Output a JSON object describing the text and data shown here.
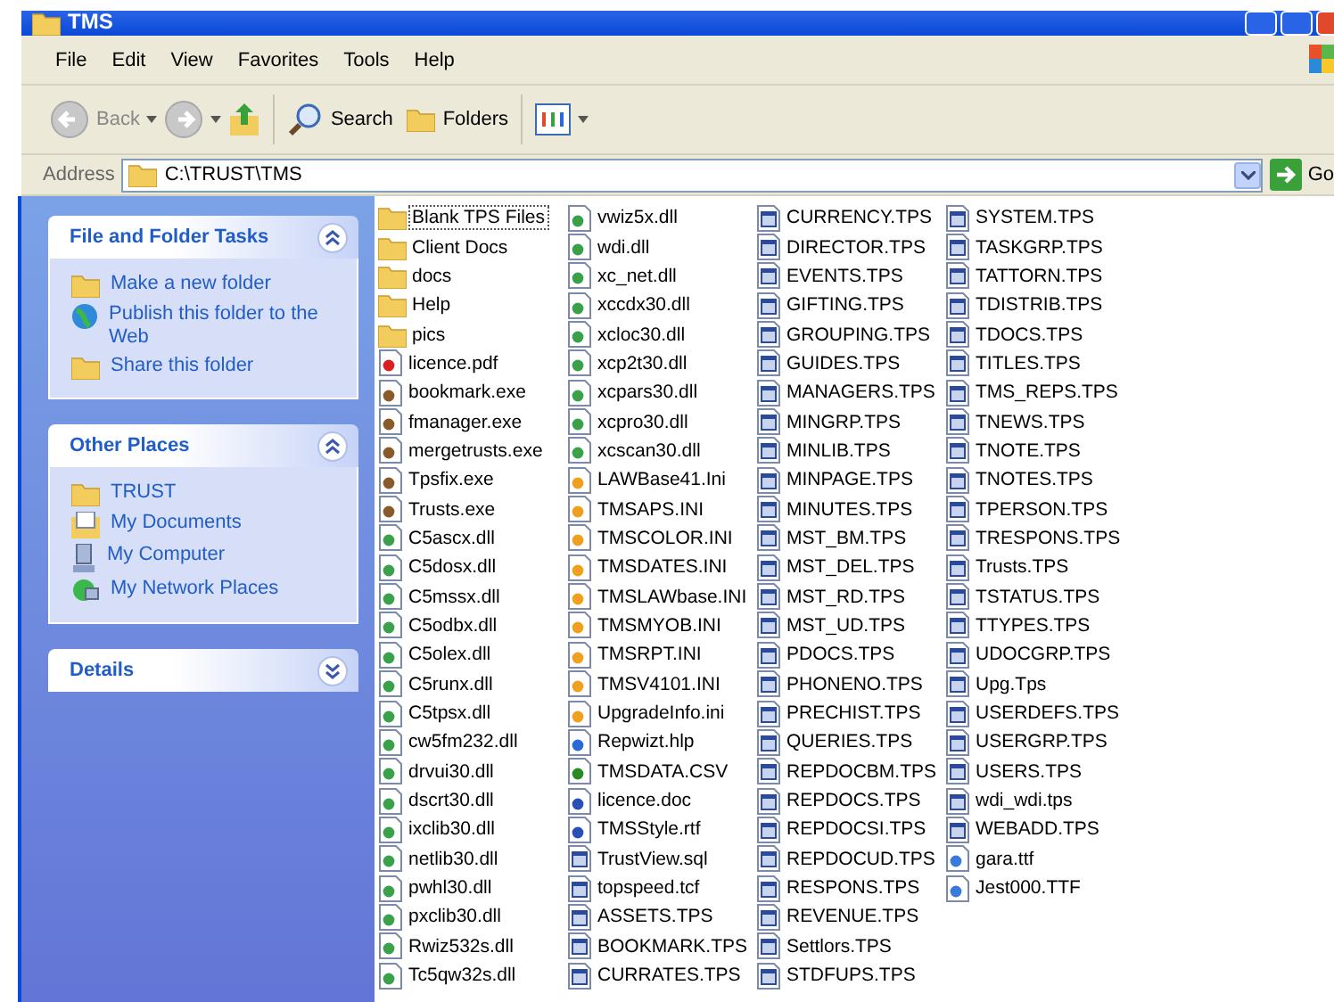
{
  "window": {
    "title": "TMS"
  },
  "menu": [
    "File",
    "Edit",
    "View",
    "Favorites",
    "Tools",
    "Help"
  ],
  "toolbar": {
    "back": {
      "label": "Back",
      "disabled": true
    },
    "forward": {
      "disabled": true
    },
    "search": "Search",
    "folders": "Folders"
  },
  "address": {
    "label": "Address",
    "value": "C:\\TRUST\\TMS",
    "go": "Go"
  },
  "task_panels": [
    {
      "title": "File and Folder Tasks",
      "expanded": true,
      "items": [
        {
          "label": "Make a new folder",
          "kind": "new-folder"
        },
        {
          "label": "Publish this folder to the Web",
          "kind": "globe"
        },
        {
          "label": "Share this folder",
          "kind": "share"
        }
      ]
    },
    {
      "title": "Other Places",
      "expanded": true,
      "items": [
        {
          "label": "TRUST",
          "kind": "folder"
        },
        {
          "label": "My Documents",
          "kind": "documents"
        },
        {
          "label": "My Computer",
          "kind": "computer"
        },
        {
          "label": "My Network Places",
          "kind": "network"
        }
      ]
    },
    {
      "title": "Details",
      "expanded": false
    }
  ],
  "files": {
    "columns": [
      [
        {
          "name": "Blank TPS Files",
          "kind": "folder",
          "focused": true
        },
        {
          "name": "Client Docs",
          "kind": "folder",
          "focused": false
        },
        {
          "name": "docs",
          "kind": "folder",
          "focused": false
        },
        {
          "name": "Help",
          "kind": "folder",
          "focused": false
        },
        {
          "name": "pics",
          "kind": "folder",
          "focused": false
        },
        {
          "name": "licence.pdf",
          "kind": "pdf",
          "focused": false
        },
        {
          "name": "bookmark.exe",
          "kind": "exe",
          "focused": false
        },
        {
          "name": "fmanager.exe",
          "kind": "exe",
          "focused": false
        },
        {
          "name": "mergetrusts.exe",
          "kind": "exe",
          "focused": false
        },
        {
          "name": "Tpsfix.exe",
          "kind": "exe",
          "focused": false
        },
        {
          "name": "Trusts.exe",
          "kind": "exe",
          "focused": false
        },
        {
          "name": "C5ascx.dll",
          "kind": "dll",
          "focused": false
        },
        {
          "name": "C5dosx.dll",
          "kind": "dll",
          "focused": false
        },
        {
          "name": "C5mssx.dll",
          "kind": "dll",
          "focused": false
        },
        {
          "name": "C5odbx.dll",
          "kind": "dll",
          "focused": false
        },
        {
          "name": "C5olex.dll",
          "kind": "dll",
          "focused": false
        },
        {
          "name": "C5runx.dll",
          "kind": "dll",
          "focused": false
        },
        {
          "name": "C5tpsx.dll",
          "kind": "dll",
          "focused": false
        },
        {
          "name": "cw5fm232.dll",
          "kind": "dll",
          "focused": false
        },
        {
          "name": "drvui30.dll",
          "kind": "dll",
          "focused": false
        },
        {
          "name": "dscrt30.dll",
          "kind": "dll",
          "focused": false
        },
        {
          "name": "ixclib30.dll",
          "kind": "dll",
          "focused": false
        },
        {
          "name": "netlib30.dll",
          "kind": "dll",
          "focused": false
        },
        {
          "name": "pwhl30.dll",
          "kind": "dll",
          "focused": false
        },
        {
          "name": "pxclib30.dll",
          "kind": "dll",
          "focused": false
        },
        {
          "name": "Rwiz532s.dll",
          "kind": "dll",
          "focused": false
        },
        {
          "name": "Tc5qw32s.dll",
          "kind": "dll",
          "focused": false
        }
      ],
      [
        {
          "name": "vwiz5x.dll",
          "kind": "dll",
          "focused": false
        },
        {
          "name": "wdi.dll",
          "kind": "dll",
          "focused": false
        },
        {
          "name": "xc_net.dll",
          "kind": "dll",
          "focused": false
        },
        {
          "name": "xccdx30.dll",
          "kind": "dll",
          "focused": false
        },
        {
          "name": "xcloc30.dll",
          "kind": "dll",
          "focused": false
        },
        {
          "name": "xcp2t30.dll",
          "kind": "dll",
          "focused": false
        },
        {
          "name": "xcpars30.dll",
          "kind": "dll",
          "focused": false
        },
        {
          "name": "xcpro30.dll",
          "kind": "dll",
          "focused": false
        },
        {
          "name": "xcscan30.dll",
          "kind": "dll",
          "focused": false
        },
        {
          "name": "LAWBase41.Ini",
          "kind": "ini",
          "focused": false
        },
        {
          "name": "TMSAPS.INI",
          "kind": "ini",
          "focused": false
        },
        {
          "name": "TMSCOLOR.INI",
          "kind": "ini",
          "focused": false
        },
        {
          "name": "TMSDATES.INI",
          "kind": "ini",
          "focused": false
        },
        {
          "name": "TMSLAWbase.INI",
          "kind": "ini",
          "focused": false
        },
        {
          "name": "TMSMYOB.INI",
          "kind": "ini",
          "focused": false
        },
        {
          "name": "TMSRPT.INI",
          "kind": "ini",
          "focused": false
        },
        {
          "name": "TMSV4101.INI",
          "kind": "ini",
          "focused": false
        },
        {
          "name": "UpgradeInfo.ini",
          "kind": "ini",
          "focused": false
        },
        {
          "name": "Repwizt.hlp",
          "kind": "hlp",
          "focused": false
        },
        {
          "name": "TMSDATA.CSV",
          "kind": "csv",
          "focused": false
        },
        {
          "name": "licence.doc",
          "kind": "doc",
          "focused": false
        },
        {
          "name": "TMSStyle.rtf",
          "kind": "doc",
          "focused": false
        },
        {
          "name": "TrustView.sql",
          "kind": "tps",
          "focused": false
        },
        {
          "name": "topspeed.tcf",
          "kind": "tps",
          "focused": false
        },
        {
          "name": "ASSETS.TPS",
          "kind": "tps",
          "focused": false
        },
        {
          "name": "BOOKMARK.TPS",
          "kind": "tps",
          "focused": false
        },
        {
          "name": "CURRATES.TPS",
          "kind": "tps",
          "focused": false
        }
      ],
      [
        {
          "name": "CURRENCY.TPS",
          "kind": "tps",
          "focused": false
        },
        {
          "name": "DIRECTOR.TPS",
          "kind": "tps",
          "focused": false
        },
        {
          "name": "EVENTS.TPS",
          "kind": "tps",
          "focused": false
        },
        {
          "name": "GIFTING.TPS",
          "kind": "tps",
          "focused": false
        },
        {
          "name": "GROUPING.TPS",
          "kind": "tps",
          "focused": false
        },
        {
          "name": "GUIDES.TPS",
          "kind": "tps",
          "focused": false
        },
        {
          "name": "MANAGERS.TPS",
          "kind": "tps",
          "focused": false
        },
        {
          "name": "MINGRP.TPS",
          "kind": "tps",
          "focused": false
        },
        {
          "name": "MINLIB.TPS",
          "kind": "tps",
          "focused": false
        },
        {
          "name": "MINPAGE.TPS",
          "kind": "tps",
          "focused": false
        },
        {
          "name": "MINUTES.TPS",
          "kind": "tps",
          "focused": false
        },
        {
          "name": "MST_BM.TPS",
          "kind": "tps",
          "focused": false
        },
        {
          "name": "MST_DEL.TPS",
          "kind": "tps",
          "focused": false
        },
        {
          "name": "MST_RD.TPS",
          "kind": "tps",
          "focused": false
        },
        {
          "name": "MST_UD.TPS",
          "kind": "tps",
          "focused": false
        },
        {
          "name": "PDOCS.TPS",
          "kind": "tps",
          "focused": false
        },
        {
          "name": "PHONENO.TPS",
          "kind": "tps",
          "focused": false
        },
        {
          "name": "PRECHIST.TPS",
          "kind": "tps",
          "focused": false
        },
        {
          "name": "QUERIES.TPS",
          "kind": "tps",
          "focused": false
        },
        {
          "name": "REPDOCBM.TPS",
          "kind": "tps",
          "focused": false
        },
        {
          "name": "REPDOCS.TPS",
          "kind": "tps",
          "focused": false
        },
        {
          "name": "REPDOCSI.TPS",
          "kind": "tps",
          "focused": false
        },
        {
          "name": "REPDOCUD.TPS",
          "kind": "tps",
          "focused": false
        },
        {
          "name": "RESPONS.TPS",
          "kind": "tps",
          "focused": false
        },
        {
          "name": "REVENUE.TPS",
          "kind": "tps",
          "focused": false
        },
        {
          "name": "Settlors.TPS",
          "kind": "tps",
          "focused": false
        },
        {
          "name": "STDFUPS.TPS",
          "kind": "tps",
          "focused": false
        }
      ],
      [
        {
          "name": "SYSTEM.TPS",
          "kind": "tps",
          "focused": false
        },
        {
          "name": "TASKGRP.TPS",
          "kind": "tps",
          "focused": false
        },
        {
          "name": "TATTORN.TPS",
          "kind": "tps",
          "focused": false
        },
        {
          "name": "TDISTRIB.TPS",
          "kind": "tps",
          "focused": false
        },
        {
          "name": "TDOCS.TPS",
          "kind": "tps",
          "focused": false
        },
        {
          "name": "TITLES.TPS",
          "kind": "tps",
          "focused": false
        },
        {
          "name": "TMS_REPS.TPS",
          "kind": "tps",
          "focused": false
        },
        {
          "name": "TNEWS.TPS",
          "kind": "tps",
          "focused": false
        },
        {
          "name": "TNOTE.TPS",
          "kind": "tps",
          "focused": false
        },
        {
          "name": "TNOTES.TPS",
          "kind": "tps",
          "focused": false
        },
        {
          "name": "TPERSON.TPS",
          "kind": "tps",
          "focused": false
        },
        {
          "name": "TRESPONS.TPS",
          "kind": "tps",
          "focused": false
        },
        {
          "name": "Trusts.TPS",
          "kind": "tps",
          "focused": false
        },
        {
          "name": "TSTATUS.TPS",
          "kind": "tps",
          "focused": false
        },
        {
          "name": "TTYPES.TPS",
          "kind": "tps",
          "focused": false
        },
        {
          "name": "UDOCGRP.TPS",
          "kind": "tps",
          "focused": false
        },
        {
          "name": "Upg.Tps",
          "kind": "tps",
          "focused": false
        },
        {
          "name": "USERDEFS.TPS",
          "kind": "tps",
          "focused": false
        },
        {
          "name": "USERGRP.TPS",
          "kind": "tps",
          "focused": false
        },
        {
          "name": "USERS.TPS",
          "kind": "tps",
          "focused": false
        },
        {
          "name": "wdi_wdi.tps",
          "kind": "tps",
          "focused": false
        },
        {
          "name": "WEBADD.TPS",
          "kind": "tps",
          "focused": false
        },
        {
          "name": "gara.ttf",
          "kind": "ttf",
          "focused": false
        },
        {
          "name": "Jest000.TTF",
          "kind": "ttf",
          "focused": false
        }
      ]
    ]
  }
}
